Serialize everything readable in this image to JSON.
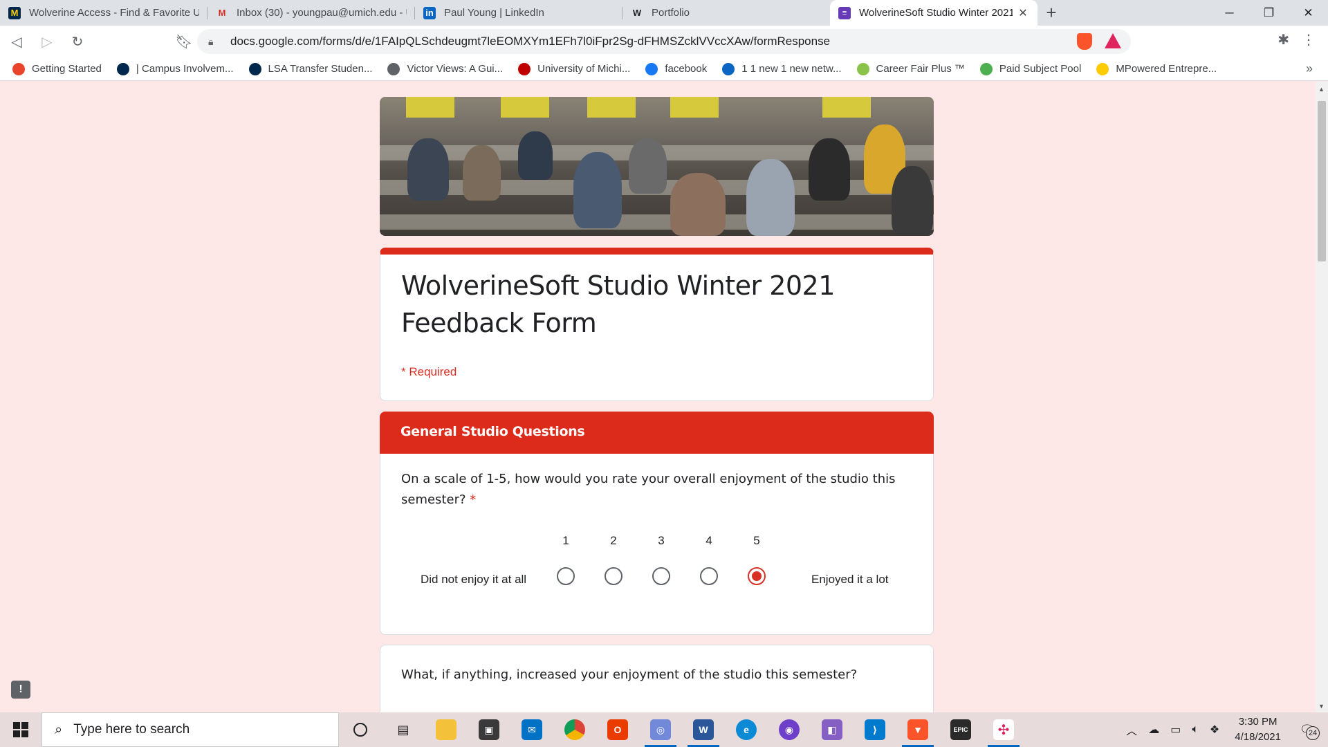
{
  "browser": {
    "tabs": [
      {
        "title": "Wolverine Access - Find & Favorite Ur",
        "icon": "umich-m-icon",
        "active": false
      },
      {
        "title": "Inbox (30) - youngpau@umich.edu - U",
        "icon": "gmail-icon",
        "active": false
      },
      {
        "title": "Paul Young | LinkedIn",
        "icon": "linkedin-icon",
        "active": false
      },
      {
        "title": "Portfolio",
        "icon": "wix-icon",
        "active": false
      },
      {
        "title": "WolverineSoft Studio Winter 2021",
        "icon": "google-forms-icon",
        "active": true
      }
    ],
    "new_tab": "+",
    "url": "docs.google.com/forms/d/e/1FAIpQLSchdeugmt7leEOMXYm1EFh7l0iFpr2Sg-dFHMSZcklVVccXAw/formResponse",
    "bookmarks": [
      {
        "label": "Getting Started",
        "color": "#e8452c"
      },
      {
        "label": "| Campus Involvem...",
        "color": "#00274c"
      },
      {
        "label": "LSA Transfer Studen...",
        "color": "#00274c"
      },
      {
        "label": "Victor Views: A Gui...",
        "color": "#5f6368"
      },
      {
        "label": "University of Michi...",
        "color": "#c00000"
      },
      {
        "label": "facebook",
        "color": "#1877f2"
      },
      {
        "label": "1 1 new 1 new netw...",
        "color": "#0a66c2"
      },
      {
        "label": "Career Fair Plus ™",
        "color": "#8bc34a"
      },
      {
        "label": "Paid Subject Pool",
        "color": "#4caf50"
      },
      {
        "label": "MPowered Entrepre...",
        "color": "#ffcb05"
      }
    ],
    "bookmarks_more": "»"
  },
  "form": {
    "title": "WolverineSoft Studio Winter 2021 Feedback Form",
    "required_note": "* Required",
    "section_title": "General Studio Questions",
    "accent": "#dc2b1b",
    "q1": {
      "text": "On a scale of 1-5, how would you rate your overall enjoyment of the studio this semester?",
      "required_mark": "*",
      "scale": [
        "1",
        "2",
        "3",
        "4",
        "5"
      ],
      "selected": 5,
      "low_label": "Did not enjoy it at all",
      "high_label": "Enjoyed it a lot"
    },
    "q2": {
      "text": "What, if anything, increased your enjoyment of the studio this semester?"
    }
  },
  "taskbar": {
    "search_placeholder": "Type here to search",
    "time": "3:30 PM",
    "date": "4/18/2021",
    "notifications": "24"
  }
}
